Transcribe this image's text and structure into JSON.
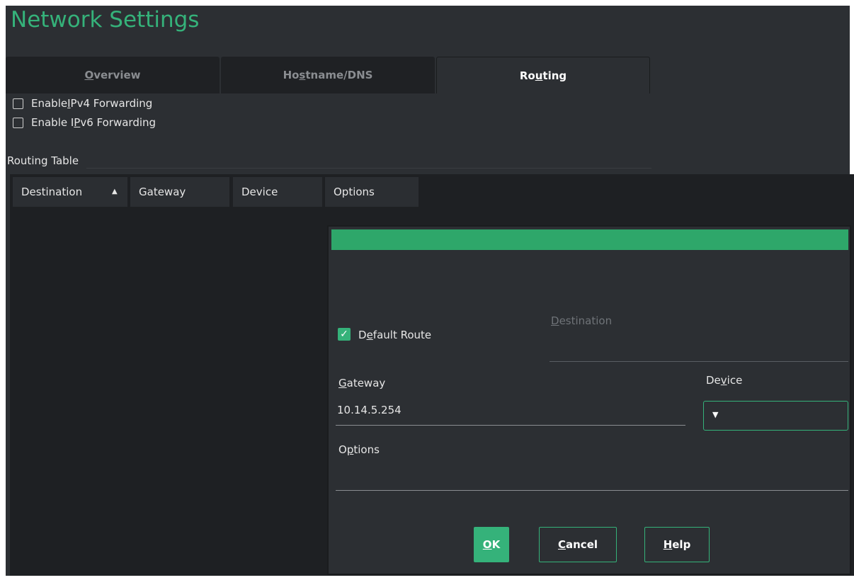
{
  "window": {
    "title": "Network Settings"
  },
  "tabs": [
    {
      "pre": "",
      "accel": "O",
      "post": "verview",
      "active": false
    },
    {
      "pre": "Ho",
      "accel": "s",
      "post": "tname/DNS",
      "active": false
    },
    {
      "pre": "Ro",
      "accel": "u",
      "post": "ting",
      "active": true
    }
  ],
  "forwarding": {
    "ipv4": {
      "pre": "Enable ",
      "accel": "I",
      "post": "Pv4 Forwarding",
      "checked": false
    },
    "ipv6": {
      "pre": "Enable I",
      "accel": "P",
      "post": "v6 Forwarding",
      "checked": false
    }
  },
  "routing_table": {
    "label": "Routing Table",
    "columns": [
      "Destination",
      "Gateway",
      "Device",
      "Options"
    ],
    "sort_icon": "sort-ascending-icon"
  },
  "dialog": {
    "default_route": {
      "pre": "D",
      "accel": "e",
      "post": "fault Route",
      "checked": true
    },
    "destination": {
      "pre": "",
      "accel": "D",
      "post": "estination",
      "value": ""
    },
    "gateway": {
      "pre": "",
      "accel": "G",
      "post": "ateway",
      "value": "10.14.5.254"
    },
    "device": {
      "pre": "De",
      "accel": "v",
      "post": "ice",
      "value": ""
    },
    "options": {
      "pre": "O",
      "accel": "p",
      "post": "tions",
      "value": ""
    },
    "buttons": {
      "ok": {
        "pre": "",
        "accel": "O",
        "post": "K"
      },
      "cancel": {
        "pre": "",
        "accel": "C",
        "post": "ancel"
      },
      "help": {
        "pre": "",
        "accel": "H",
        "post": "elp"
      }
    }
  },
  "colors": {
    "accent": "#35b27a",
    "header": "#2ea76a",
    "background": "#2c2f33",
    "table": "#1e2023"
  }
}
